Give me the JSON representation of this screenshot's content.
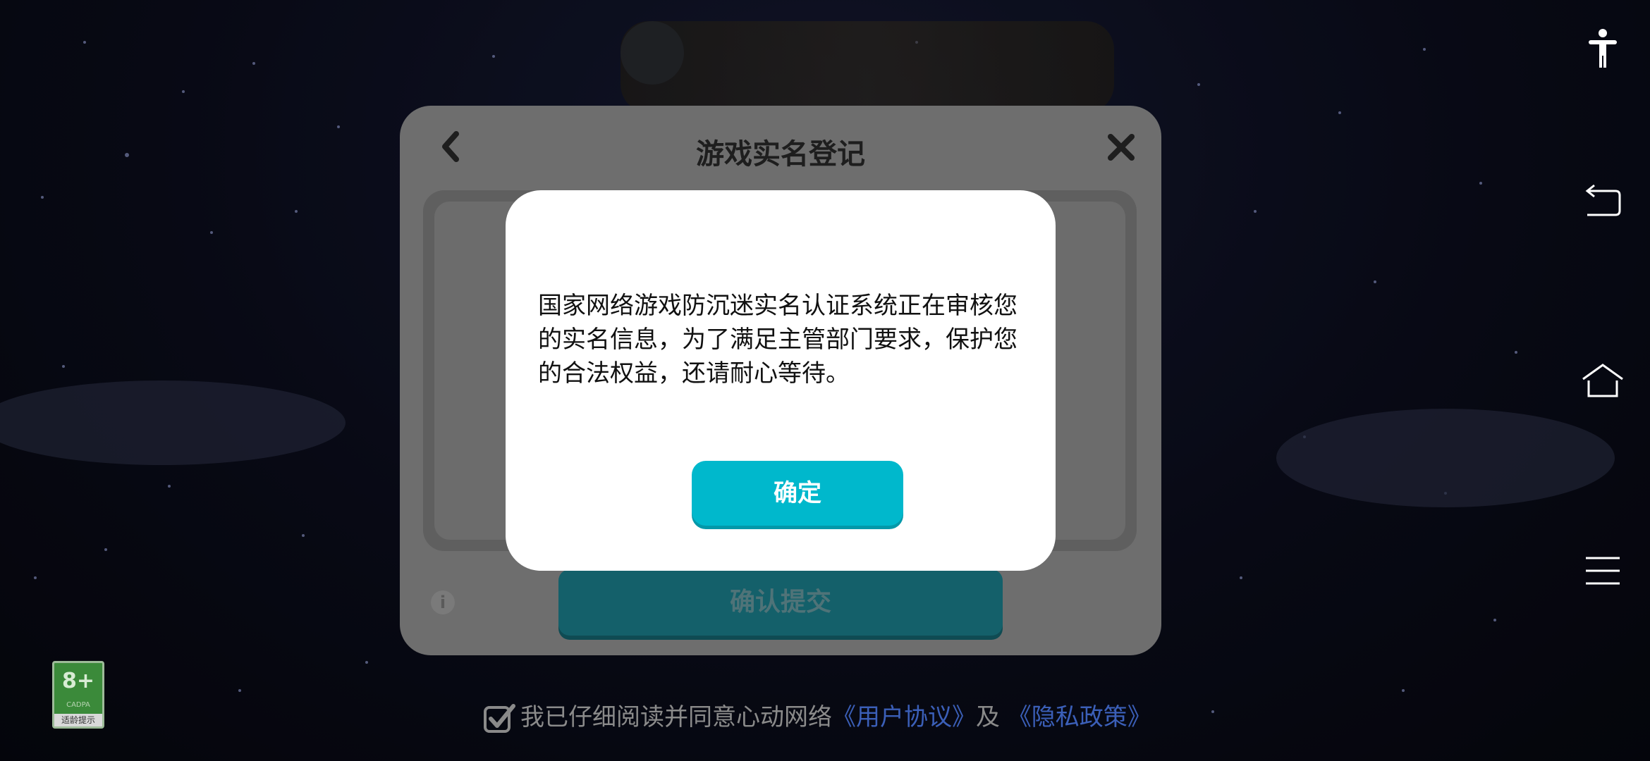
{
  "background_dialog": {
    "title": "游戏实名登记",
    "submit_label": "确认提交",
    "info_glyph": "i"
  },
  "alert": {
    "message": "国家网络游戏防沉迷实名认证系统正在审核您的实名信息，为了满足主管部门要求，保护您的合法权益，还请耐心等待。",
    "confirm_label": "确定"
  },
  "age_rating": {
    "value": "8+",
    "org": "CADPA",
    "tip": "适龄提示"
  },
  "agreement": {
    "checked": true,
    "text": "我已仔细阅读并同意心动网络",
    "user_agreement_link": "《用户协议》",
    "conjunction": "及",
    "privacy_policy_link": "《隐私政策》"
  },
  "nav_bar": {
    "icons": [
      "accessibility-icon",
      "back-icon",
      "home-icon",
      "menu-icon"
    ]
  },
  "colors": {
    "accent": "#00b8cc",
    "link": "#3b5fb8",
    "age_badge": "#3b8a3a"
  }
}
